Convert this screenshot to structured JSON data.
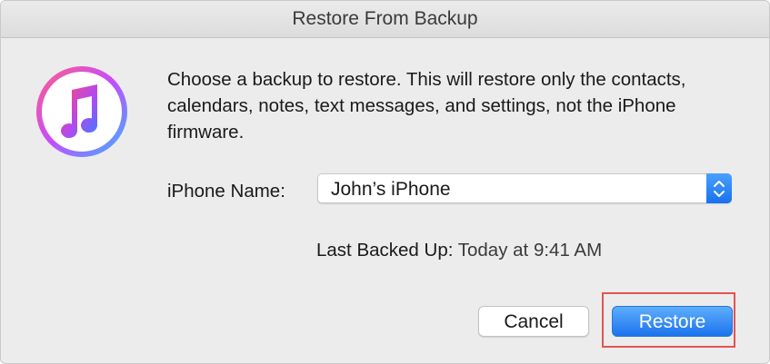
{
  "window": {
    "title": "Restore From Backup"
  },
  "icon": {
    "name": "itunes-music-note-icon"
  },
  "message": "Choose a backup to restore. This will restore only the contacts, calendars, notes, text messages, and settings, not the iPhone firmware.",
  "iphone_name": {
    "label": "iPhone Name:",
    "selected": "John’s iPhone"
  },
  "last_backup": {
    "label": "Last Backed Up:",
    "value": "Today at 9:41 AM"
  },
  "buttons": {
    "cancel": "Cancel",
    "restore": "Restore"
  },
  "colors": {
    "accent": "#1b73ee",
    "highlight": "#e55353"
  }
}
